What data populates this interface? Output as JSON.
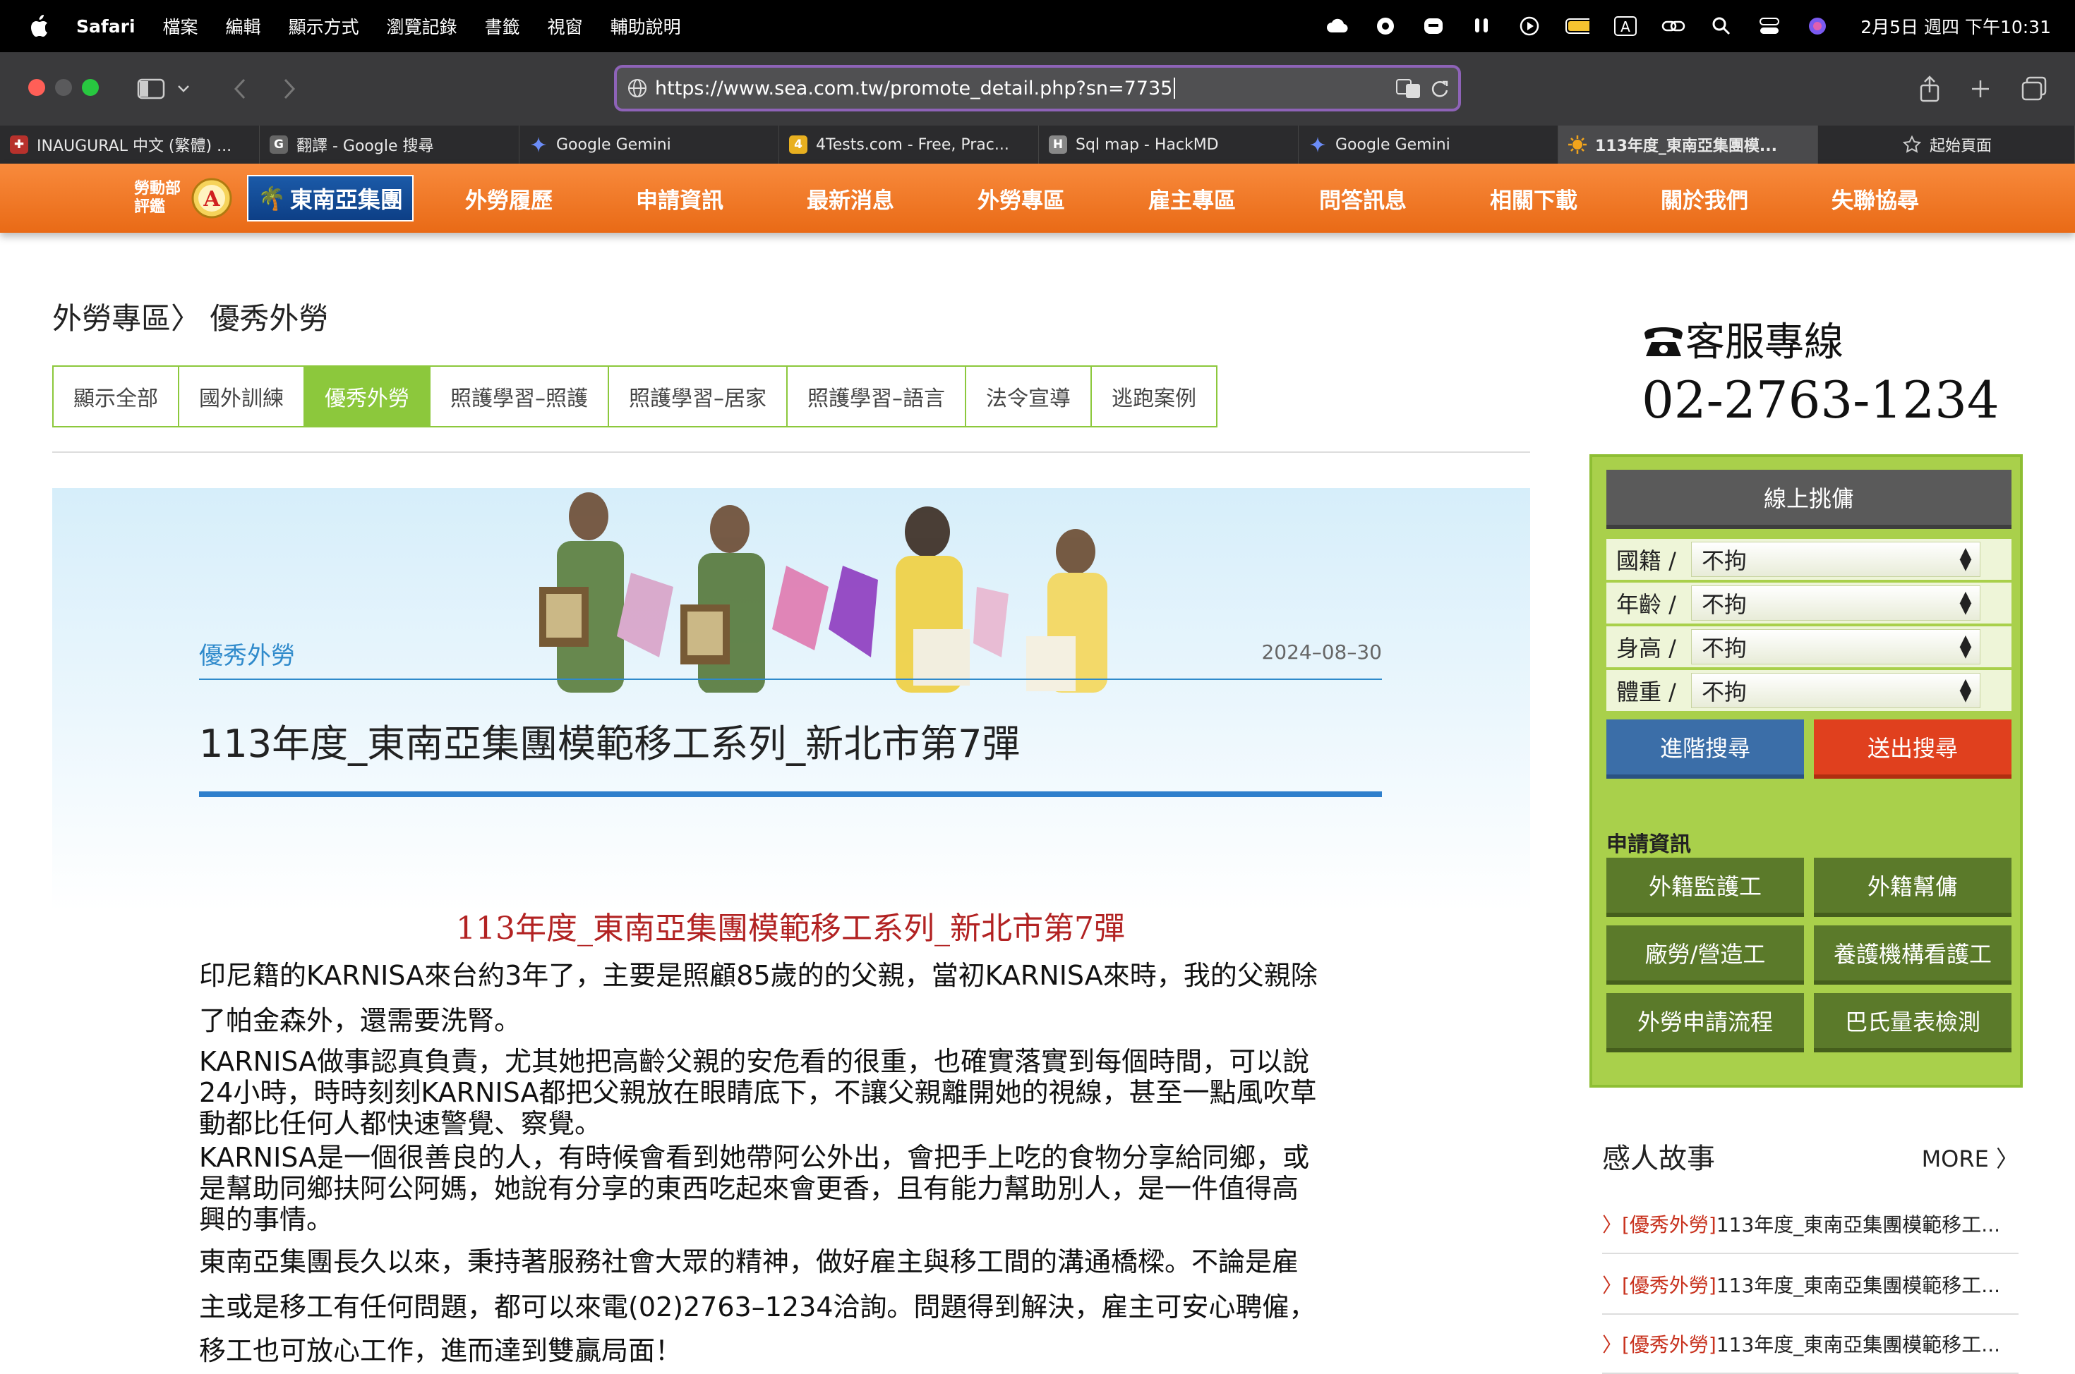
{
  "menubar": {
    "app": "Safari",
    "items": [
      "檔案",
      "編輯",
      "顯示方式",
      "瀏覽記錄",
      "書籤",
      "視窗",
      "輔助說明"
    ],
    "clock": "2月5日 週四 下午10:31"
  },
  "browser": {
    "url": "https://www.sea.com.tw/promote_detail.php?sn=7735",
    "tabs": [
      {
        "label": "INAUGURAL 中文 (繁體) ...",
        "favicon": "flag-icon"
      },
      {
        "label": "翻譯 - Google 搜尋",
        "favicon": "G"
      },
      {
        "label": "Google Gemini",
        "favicon": "gemini-icon"
      },
      {
        "label": "4Tests.com - Free, Prac...",
        "favicon": "4tests-icon"
      },
      {
        "label": "Sql map - HackMD",
        "favicon": "H"
      },
      {
        "label": "Google Gemini",
        "favicon": "gemini-icon"
      },
      {
        "label": "113年度_東南亞集團模...",
        "favicon": "sun-icon"
      },
      {
        "label": "起始頁面",
        "favicon": "star-icon"
      }
    ]
  },
  "site": {
    "award_text": "勞動部評鑑",
    "award_grade": "A",
    "logo_text": "東南亞集團",
    "nav": [
      "外勞履歷",
      "申請資訊",
      "最新消息",
      "外勞專區",
      "雇主專區",
      "問答訊息",
      "相關下載",
      "關於我們",
      "失聯協尋"
    ]
  },
  "breadcrumb": "外勞專區〉 優秀外勞",
  "filters": [
    {
      "label": "顯示全部",
      "active": false
    },
    {
      "label": "國外訓練",
      "active": false
    },
    {
      "label": "優秀外勞",
      "active": true
    },
    {
      "label": "照護學習–照護",
      "active": false
    },
    {
      "label": "照護學習–居家",
      "active": false
    },
    {
      "label": "照護學習–語言",
      "active": false
    },
    {
      "label": "法令宣導",
      "active": false
    },
    {
      "label": "逃跑案例",
      "active": false
    }
  ],
  "article": {
    "category": "優秀外勞",
    "date": "2024–08–30",
    "title": "113年度_東南亞集團模範移工系列_新北市第7彈",
    "headline": "113年度_東南亞集團模範移工系列_新北市第7彈",
    "lines": [
      "印尼籍的KARNISA來台約3年了，主要是照顧85歲的的父親，當初KARNISA來時，我的父親除",
      "了帕金森外，還需要洗腎。",
      "KARNISA做事認真負責，尤其她把高齡父親的安危看的很重，也確實落實到每個時間，可以說",
      "24小時，時時刻刻KARNISA都把父親放在眼睛底下，不讓父親離開她的視線，甚至一點風吹草",
      "動都比任何人都快速警覺、察覺。",
      "KARNISA是一個很善良的人，有時候會看到她帶阿公外出，會把手上吃的食物分享給同鄉，或",
      "是幫助同鄉扶阿公阿媽，她說有分享的東西吃起來會更香，且有能力幫助別人，是一件值得高",
      "興的事情。",
      "東南亞集團長久以來，秉持著服務社會大眾的精神，做好雇主與移工間的溝通橋樑。不論是雇",
      "主或是移工有任何問題，都可以來電(02)2763–1234洽詢。問題得到解決，雇主可安心聘僱，",
      "移工也可放心工作，進而達到雙贏局面！"
    ]
  },
  "sidebar": {
    "hotline_label": "客服專線",
    "hotline_number": "02-2763-1234",
    "panel_title": "線上挑傭",
    "selects": [
      {
        "label": "國籍 /",
        "value": "不拘"
      },
      {
        "label": "年齡 /",
        "value": "不拘"
      },
      {
        "label": "身高 /",
        "value": "不拘"
      },
      {
        "label": "體重 /",
        "value": "不拘"
      }
    ],
    "advanced_search": "進階搜尋",
    "submit_search": "送出搜尋",
    "apply_heading": "申請資訊",
    "apply_buttons": [
      "外籍監護工",
      "外籍幫傭",
      "廠勞/營造工",
      "養護機構看護工",
      "外勞申請流程",
      "巴氏量表檢測"
    ],
    "stories_heading": "感人故事",
    "stories_more": "MORE 〉",
    "stories": [
      {
        "tag": "〉[優秀外勞]",
        "title": "113年度_東南亞集團模範移工..."
      },
      {
        "tag": "〉[優秀外勞]",
        "title": "113年度_東南亞集團模範移工..."
      },
      {
        "tag": "〉[優秀外勞]",
        "title": "113年度_東南亞集團模範移工..."
      }
    ]
  },
  "colors": {
    "nav_orange": "#f07a26",
    "accent_green": "#8cc83c",
    "blue": "#2f7fcc",
    "red": "#b22222"
  }
}
